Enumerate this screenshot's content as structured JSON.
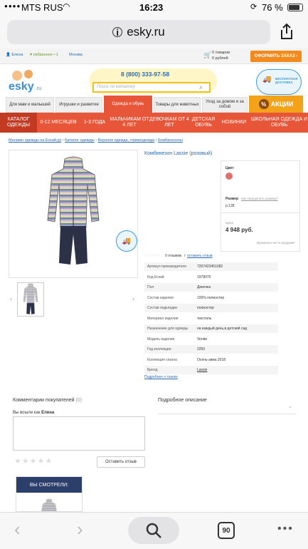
{
  "status": {
    "carrier": "MTS RUS",
    "time": "16:23",
    "battery": "76 %"
  },
  "browser": {
    "url": "esky.ru",
    "tab_count": "90"
  },
  "site": {
    "user": "Елена",
    "favorites": "избранное • 1",
    "city": "Москва",
    "cart_items": "0 товаров",
    "cart_sum": "0 рублей",
    "checkout_label": "ОФОРМИТЬ ЗАКАЗ ›",
    "logo": "esky",
    "logo_tld": ".ru",
    "phone": "8 (800) 333-97-58",
    "search_placeholder": "Поиск по каталогу",
    "free_delivery": "БЕСПЛАТНАЯ ДОСТАВКА",
    "promo_label": "АКЦИИ"
  },
  "category_tabs": [
    "Для мам и малышей",
    "Игрушки и развитие",
    "Одежда и обувь",
    "Товары для животных",
    "Уход за домом и за собой"
  ],
  "orange_nav": [
    "КАТАЛОГ ОДЕЖДЫ",
    "0-12 МЕСЯЦЕВ",
    "1-3 ГОДА",
    "МАЛЬЧИКАМ ОТ 4 ЛЕТ",
    "ДЕВОЧКАМ ОТ 4 ЛЕТ",
    "ДЕТСКАЯ ОБУВЬ",
    "НОВИНКИ",
    "ШКОЛЬНАЯ ОДЕЖДА И ОБУВЬ"
  ],
  "breadcrumbs": [
    "Магазин одежды на Eскай.ру",
    "Каталог одежды",
    "Верхняя одежда, термоодежда",
    "Комбинезоны"
  ],
  "product": {
    "title": "Комбинезон Lassie (розовый)",
    "color_label": "Цвет",
    "color": "#e07070",
    "size_label": "Размер",
    "size_help": "Как определить размер?",
    "size_value": "р.128",
    "price_label": "Цена",
    "price": "4 948 руб.",
    "availability": "Временно нет в продаже!",
    "reviews": "0 отзывов",
    "leave_review": "оставить отзыв",
    "specs": [
      {
        "k": "Артикул производителя",
        "v": "7207423451082"
      },
      {
        "k": "Код Eскай",
        "v": "1978070"
      },
      {
        "k": "Пол",
        "v": "Девочка"
      },
      {
        "k": "Состав изделия",
        "v": "100% полиэстер"
      },
      {
        "k": "Состав подкладки",
        "v": "полиэстер"
      },
      {
        "k": "Материал изделия",
        "v": "текстиль"
      },
      {
        "k": "Назначение для одежды",
        "v": "на каждый день,в детский сад"
      },
      {
        "k": "Модель изделия",
        "v": "Vende"
      },
      {
        "k": "Год коллекции",
        "v": "2250"
      },
      {
        "k": "Коллекция сезона",
        "v": "Осень-зима 2018"
      },
      {
        "k": "Бренд",
        "v": "Lassie"
      }
    ],
    "more_link": "Подробнее о тканях"
  },
  "comments": {
    "title": "Комментарии покупателей",
    "count": "(0)",
    "logged_in_as": "Вы вошли как",
    "user": "Елена",
    "submit_label": "Оставить отзыв",
    "description_title": "Подробное описание"
  },
  "seen": {
    "title": "ВЫ СМОТРЕЛИ:"
  }
}
